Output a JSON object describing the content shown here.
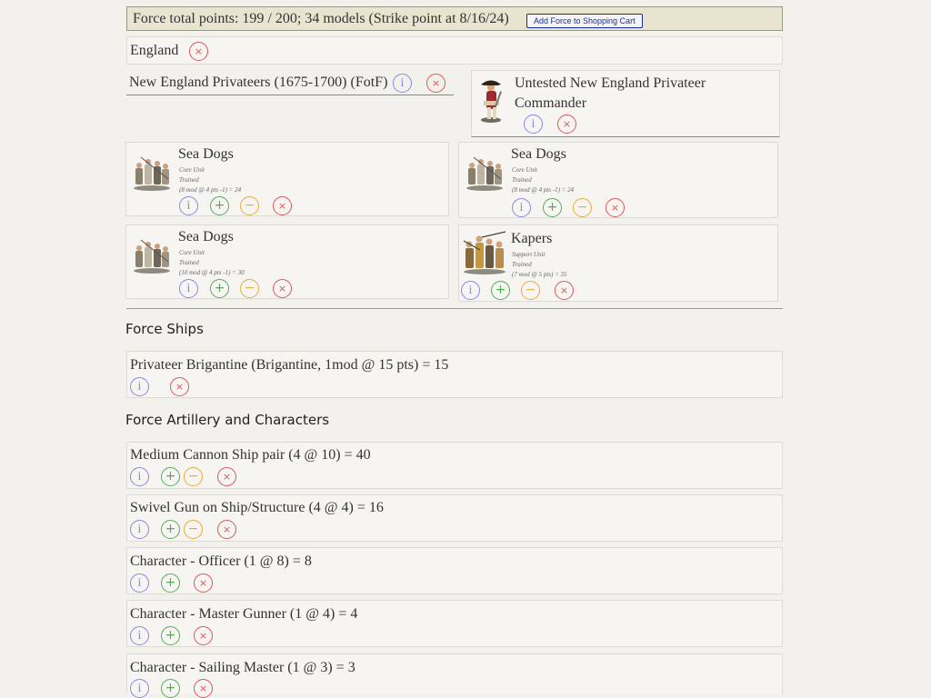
{
  "summary": {
    "text": "Force total points: 199 / 200; 34 models (Strike point at 8/16/24)",
    "cart_button": "Add Force to Shopping Cart"
  },
  "nation": {
    "name": "England"
  },
  "force": {
    "name": "New England Privateers (1675-1700) (FotF)"
  },
  "commander": {
    "name_line1": "Untested New England Privateer",
    "name_line2": "Commander"
  },
  "units": [
    {
      "name": "Sea Dogs",
      "type": "Core Unit",
      "training": "Trained",
      "calc": "(8 mod @ 4 pts -1) = 24"
    },
    {
      "name": "Sea Dogs",
      "type": "Core Unit",
      "training": "Trained",
      "calc": "(8 mod @ 4 pts -1) = 24"
    },
    {
      "name": "Sea Dogs",
      "type": "Core Unit",
      "training": "Trained",
      "calc": "(10 mod @ 4 pts -1) = 30"
    },
    {
      "name": "Kapers",
      "type": "Support Unit",
      "training": "Trained",
      "calc": "(7 mod @ 5 pts) = 35"
    }
  ],
  "ships": {
    "heading": "Force Ships",
    "items": [
      {
        "label": "Privateer Brigantine (Brigantine, 1mod @ 15 pts) = 15"
      }
    ]
  },
  "artillery": {
    "heading": "Force Artillery and Characters",
    "items": [
      {
        "label": "Medium Cannon Ship pair (4 @ 10) = 40"
      },
      {
        "label": "Swivel Gun on Ship/Structure (4 @ 4) = 16"
      },
      {
        "label": "Character - Officer (1 @ 8) = 8"
      },
      {
        "label": "Character - Master Gunner (1 @ 4) = 4"
      },
      {
        "label": "Character - Sailing Master (1 @ 3) = 3"
      }
    ]
  },
  "icons": {
    "info": "i",
    "plus": "+",
    "minus": "−",
    "remove": "×",
    "colors": {
      "info": "#8a86e8",
      "plus": "#4fae57",
      "minus": "#e4ac3c",
      "remove": "#d6575c"
    }
  }
}
